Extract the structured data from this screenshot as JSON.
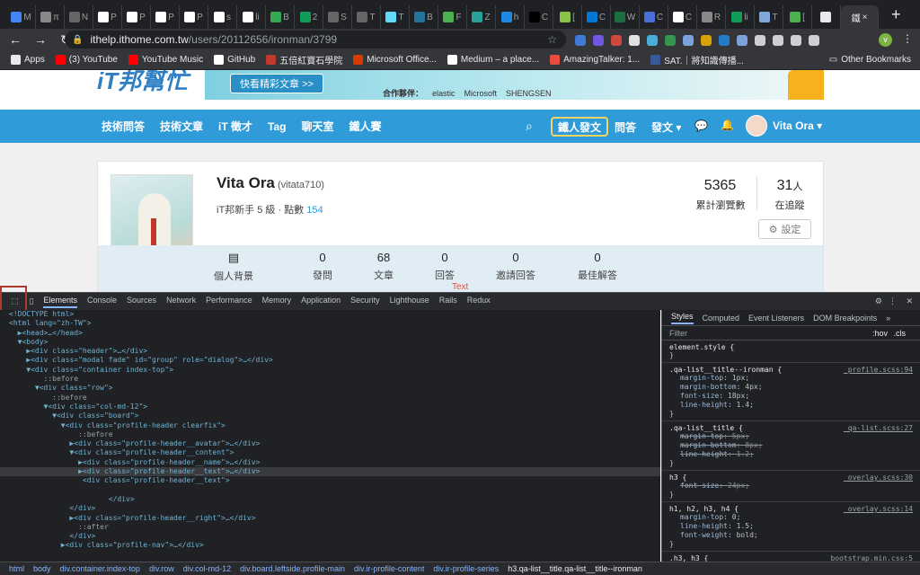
{
  "browser": {
    "tabs": [
      {
        "letter": "M",
        "color": "#4285f4"
      },
      {
        "letter": "π",
        "color": "#888"
      },
      {
        "letter": "N",
        "color": "#666"
      },
      {
        "letter": "P",
        "color": "#fff"
      },
      {
        "letter": "P",
        "color": "#fff"
      },
      {
        "letter": "P",
        "color": "#fff"
      },
      {
        "letter": "P",
        "color": "#fff"
      },
      {
        "letter": "s",
        "color": "#fff"
      },
      {
        "letter": "li",
        "color": "#fff"
      },
      {
        "letter": "B",
        "color": "#34a853"
      },
      {
        "letter": "2",
        "color": "#0f9d58"
      },
      {
        "letter": "S",
        "color": "#666"
      },
      {
        "letter": "T",
        "color": "#666"
      },
      {
        "letter": "T",
        "color": "#61dafb"
      },
      {
        "letter": "B",
        "color": "#21759b"
      },
      {
        "letter": "F",
        "color": "#4caf50"
      },
      {
        "letter": "Z",
        "color": "#2aa198"
      },
      {
        "letter": "h",
        "color": "#1e88e5"
      },
      {
        "letter": "C",
        "color": "#000"
      },
      {
        "letter": "[",
        "color": "#8bc34a"
      },
      {
        "letter": "C",
        "color": "#0078d4"
      },
      {
        "letter": "W",
        "color": "#1d6f42"
      },
      {
        "letter": "C",
        "color": "#4a6fd8"
      },
      {
        "letter": "C",
        "color": "#fff"
      },
      {
        "letter": "R",
        "color": "#888"
      },
      {
        "letter": "li",
        "color": "#0f9d58"
      },
      {
        "letter": "T",
        "color": "#7fa7d9"
      },
      {
        "letter": "[",
        "color": "#4caf50"
      },
      {
        "letter": "",
        "color": "#e8eaed"
      }
    ],
    "active_tab": "鐵",
    "url_host": "ithelp.ithome.com.tw",
    "url_path": "/users/20112656/ironman/3799",
    "bookmarks": [
      {
        "label": "Apps",
        "color": "#e8eaed"
      },
      {
        "label": "(3) YouTube",
        "color": "#ff0000"
      },
      {
        "label": "YouTube Music",
        "color": "#ff0000"
      },
      {
        "label": "GitHub",
        "color": "#fff"
      },
      {
        "label": "五倍紅寶石學院",
        "color": "#c0392b"
      },
      {
        "label": "Microsoft Office...",
        "color": "#d83b01"
      },
      {
        "label": "Medium – a place...",
        "color": "#fff"
      },
      {
        "label": "AmazingTalker: 1...",
        "color": "#e74c3c"
      },
      {
        "label": "SAT.｜將知識傳播...",
        "color": "#3b5998"
      }
    ],
    "other_bookmarks": "Other Bookmarks",
    "profile_initial": "v"
  },
  "site": {
    "logo": "iT邦幫忙",
    "ad": {
      "button": "快看精彩文章 >>",
      "partners_label": "合作夥伴：",
      "partners": [
        "elastic",
        "Microsoft",
        "SHENGSEN"
      ]
    },
    "nav": [
      "技術問答",
      "技術文章",
      "iT 徵才",
      "Tag",
      "聊天室",
      "鐵人賽"
    ],
    "nav_ironman": "鐵人發文",
    "nav_question": "問答",
    "nav_post": "發文 ▾",
    "user": "Vita Ora ▾"
  },
  "profile": {
    "name": "Vita Ora",
    "handle": "(vitata710)",
    "level": "iT邦新手 5 級 · 點數",
    "points": "154",
    "views": "5365",
    "views_label": "累計瀏覽數",
    "follow": "31",
    "follow_unit": "人",
    "follow_label": "在追蹤",
    "settings": "設定",
    "stats": [
      {
        "value": "",
        "label": "個人背景"
      },
      {
        "value": "0",
        "label": "發問"
      },
      {
        "value": "68",
        "label": "文章"
      },
      {
        "value": "0",
        "label": "回答"
      },
      {
        "value": "0",
        "label": "邀請回答"
      },
      {
        "value": "0",
        "label": "最佳解答"
      }
    ]
  },
  "ghost_text": "Text",
  "devtools": {
    "tabs": [
      "Elements",
      "Console",
      "Sources",
      "Network",
      "Performance",
      "Memory",
      "Application",
      "Security",
      "Lighthouse",
      "Rails",
      "Redux"
    ],
    "active_tab": "Elements",
    "side_tabs": [
      "Styles",
      "Computed",
      "Event Listeners",
      "DOM Breakpoints"
    ],
    "filter_placeholder": "Filter",
    "hov": ":hov",
    "cls": ".cls",
    "element_style": "element.style {",
    "rules": [
      {
        "selector": ".qa-list__title--ironman {",
        "source": "_profile.scss:94",
        "props": [
          [
            "margin-top",
            "1px"
          ],
          [
            "margin-bottom",
            "4px"
          ],
          [
            "font-size",
            "18px"
          ],
          [
            "line-height",
            "1.4"
          ]
        ],
        "strike": false
      },
      {
        "selector": ".qa-list__title {",
        "source": "_qa-list.scss:27",
        "props": [
          [
            "margin-top",
            "5px"
          ],
          [
            "margin-bottom",
            "8px"
          ],
          [
            "line-height",
            "1.2"
          ]
        ],
        "strike": true
      },
      {
        "selector": "h3 {",
        "source": "_overlay.scss:30",
        "props": [
          [
            "font-size",
            "24px"
          ]
        ],
        "strike": true
      },
      {
        "selector": "h1, h2, h3, h4 {",
        "source": "_overlay.scss:14",
        "props": [
          [
            "margin-top",
            "0"
          ],
          [
            "line-height",
            "1.5"
          ],
          [
            "font-weight",
            "bold"
          ]
        ],
        "strike": false
      },
      {
        "selector": ".h3, h3 {",
        "source": "bootstrap.min.css:5",
        "props": [
          [
            "font-size",
            "24px"
          ]
        ],
        "strike": true
      }
    ],
    "dom_lines": [
      "<!DOCTYPE html>",
      "<html lang=\"zh-TW\">",
      "  ▶<head>…</head>",
      "  ▼<body>",
      "    ▶<div class=\"header\">…</div>",
      "    ▶<div class=\"modal fade\" id=\"group\" role=\"dialog\">…</div>",
      "    ▼<div class=\"container index-top\">",
      "        ::before",
      "      ▼<div class=\"row\">",
      "          ::before",
      "        ▼<div class=\"col-md-12\">",
      "          ▼<div class=\"board\">",
      "            ▼<div class=\"profile-header clearfix\">",
      "                ::before",
      "              ▶<div class=\"profile-header__avatar\">…</div>",
      "              ▼<div class=\"profile-header__content\">",
      "                ▶<div class=\"profile-header__name\">…</div>",
      "                ▶<div class=\"profile-header__text\">…</div>",
      "                 <div class=\"profile-header__text\">",
      "",
      "                       </div>",
      "              </div>",
      "              ▶<div class=\"profile-header__right\">…</div>",
      "                ::after",
      "              </div>",
      "            ▶<div class=\"profile-nav\">…</div>"
    ],
    "selected_line": 17,
    "breadcrumbs": [
      "html",
      "body",
      "div.container.index-top",
      "div.row",
      "div.col-md-12",
      "div.board.leftside.profile-main",
      "div.ir-profile-content",
      "div.ir-profile-series",
      "h3.qa-list__title.qa-list__title--ironman"
    ]
  }
}
